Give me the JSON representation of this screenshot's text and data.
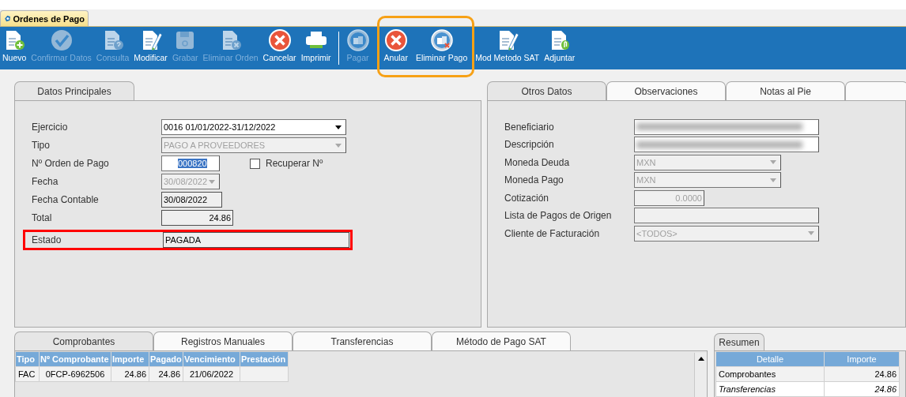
{
  "app_tab": {
    "label": "Ordenes de Pago"
  },
  "toolbar": [
    {
      "label": "Nuevo",
      "kind": "doc-plus",
      "disabled": false,
      "highlighted": false
    },
    {
      "label": "Confirmar Datos",
      "kind": "check",
      "disabled": true,
      "highlighted": false
    },
    {
      "label": "Consulta",
      "kind": "doc-question",
      "disabled": true,
      "highlighted": false
    },
    {
      "label": "Modificar",
      "kind": "doc-pencil",
      "disabled": false,
      "highlighted": false
    },
    {
      "label": "Grabar",
      "kind": "floppy",
      "disabled": true,
      "highlighted": false
    },
    {
      "label": "Eliminar Orden",
      "kind": "doc-x",
      "disabled": true,
      "highlighted": false
    },
    {
      "label": "Cancelar",
      "kind": "circle-x",
      "disabled": false,
      "highlighted": false
    },
    {
      "label": "Imprimir",
      "kind": "printer",
      "disabled": false,
      "highlighted": false
    },
    {
      "label": "Pagar",
      "kind": "coins",
      "disabled": true,
      "highlighted": false,
      "separator_before": true
    },
    {
      "label": "Anular",
      "kind": "circle-x",
      "disabled": false,
      "highlighted": true
    },
    {
      "label": "Eliminar Pago",
      "kind": "coins-x",
      "disabled": false,
      "highlighted": true
    },
    {
      "label": "Mod Metodo SAT",
      "kind": "doc-pencil",
      "disabled": false,
      "highlighted": false
    },
    {
      "label": "Adjuntar",
      "kind": "doc-clip",
      "disabled": false,
      "highlighted": false
    }
  ],
  "main": {
    "tabs": [
      {
        "label": "Datos Principales",
        "selected": true
      }
    ],
    "fields": [
      {
        "label": "Ejercicio",
        "kind": "dropdown",
        "value": "0016 01/01/2022-31/12/2022",
        "disabled": false,
        "readonly": false,
        "highlighted": false
      },
      {
        "label": "Tipo",
        "kind": "dropdown",
        "value": "PAGO A PROVEEDORES",
        "disabled": true,
        "readonly": false,
        "highlighted": false
      },
      {
        "label": "Nº Orden de Pago",
        "kind": "text",
        "value": "000820",
        "disabled": false,
        "readonly": false,
        "text_selected": true,
        "highlighted": false,
        "checkbox": {
          "label": "Recuperar Nº",
          "checked": false
        }
      },
      {
        "label": "Fecha",
        "kind": "dropdown",
        "value": "30/08/2022",
        "disabled": true,
        "readonly": false,
        "highlighted": false
      },
      {
        "label": "Fecha Contable",
        "kind": "text",
        "value": "30/08/2022",
        "disabled": false,
        "readonly": true,
        "highlighted": false
      },
      {
        "label": "Total",
        "kind": "number",
        "value": "24.86",
        "disabled": false,
        "readonly": true,
        "highlighted": false
      },
      {
        "label": "Estado",
        "kind": "text",
        "value": "PAGADA",
        "disabled": false,
        "readonly": true,
        "highlighted": true
      }
    ]
  },
  "other": {
    "tabs": [
      {
        "label": "Otros Datos",
        "selected": true
      },
      {
        "label": "Observaciones",
        "selected": false
      },
      {
        "label": "Notas al Pie",
        "selected": false
      }
    ],
    "fields": [
      {
        "label": "Beneficiario",
        "kind": "redacted",
        "disabled": false
      },
      {
        "label": "Descripción",
        "kind": "redacted",
        "disabled": false
      },
      {
        "label": "Moneda Deuda",
        "kind": "dropdown",
        "value": "MXN",
        "disabled": true
      },
      {
        "label": "Moneda Pago",
        "kind": "dropdown",
        "value": "MXN",
        "disabled": true
      },
      {
        "label": "Cotización",
        "kind": "number",
        "value": "0.0000",
        "disabled": true
      },
      {
        "label": "Lista de Pagos de Origen",
        "kind": "text",
        "disabled": true
      },
      {
        "label": "Cliente de Facturación",
        "kind": "dropdown",
        "value": "<TODOS>",
        "disabled": true
      }
    ]
  },
  "detail": {
    "tabs": [
      {
        "label": "Comprobantes",
        "selected": true
      },
      {
        "label": "Registros Manuales",
        "selected": false
      },
      {
        "label": "Transferencias",
        "selected": false
      },
      {
        "label": "Método de Pago SAT",
        "selected": false
      }
    ],
    "table": {
      "columns": [
        "Tipo",
        "Nº Comprobante",
        "Importe",
        "Pagado",
        "Vencimiento",
        "Prestación"
      ],
      "rows": [
        [
          "FAC",
          "0FCP-6962506",
          "24.86",
          "24.86",
          "21/06/2022"
        ]
      ]
    }
  },
  "summary": {
    "tabs": [
      {
        "label": "Resumen",
        "selected": true
      }
    ],
    "table": {
      "columns": [
        "Detalle",
        "Importe"
      ],
      "rows": [
        {
          "cells": [
            "Comprobantes",
            "24.86"
          ],
          "italic": false
        },
        {
          "cells": [
            "Transferencias",
            "24.86"
          ],
          "italic": true
        }
      ]
    }
  }
}
